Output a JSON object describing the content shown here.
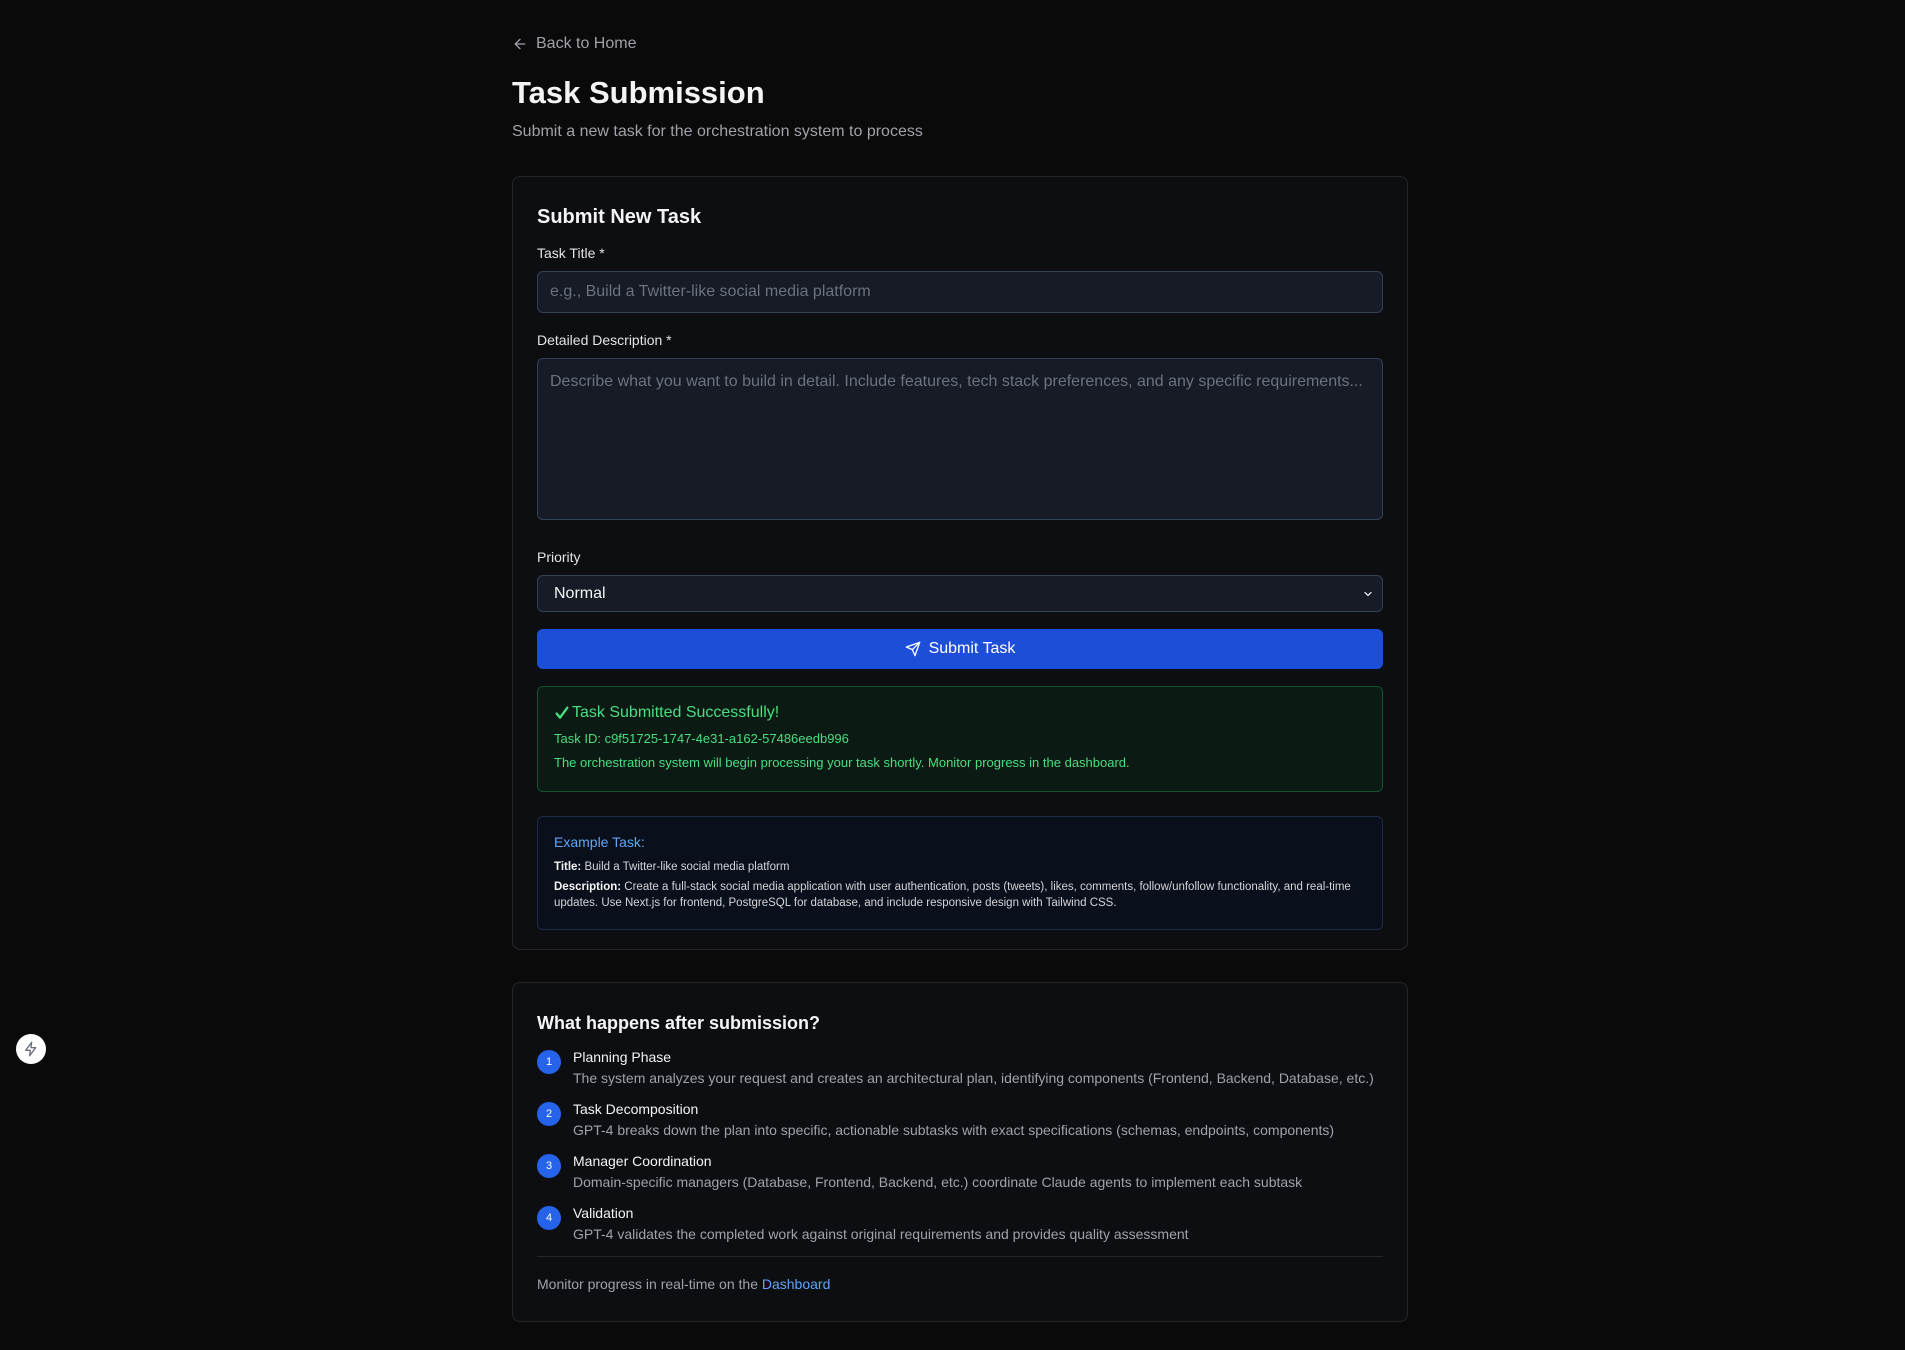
{
  "nav": {
    "back_label": "Back to Home"
  },
  "header": {
    "title": "Task Submission",
    "subtitle": "Submit a new task for the orchestration system to process"
  },
  "form": {
    "card_title": "Submit New Task",
    "title_label": "Task Title *",
    "title_placeholder": "e.g., Build a Twitter-like social media platform",
    "title_value": "",
    "description_label": "Detailed Description *",
    "description_placeholder": "Describe what you want to build in detail. Include features, tech stack preferences, and any specific requirements...",
    "description_value": "",
    "priority_label": "Priority",
    "priority_value": "Normal",
    "submit_label": "Submit Task"
  },
  "success": {
    "title": "Task Submitted Successfully!",
    "task_id": "Task ID: c9f51725-1747-4e31-a162-57486eedb996",
    "message": "The orchestration system will begin processing your task shortly. Monitor progress in the dashboard."
  },
  "example": {
    "heading": "Example Task:",
    "title_key": "Title:",
    "title_value": "Build a Twitter-like social media platform",
    "description_key": "Description:",
    "description_value": "Create a full-stack social media application with user authentication, posts (tweets), likes, comments, follow/unfollow functionality, and real-time updates. Use Next.js for frontend, PostgreSQL for database, and include responsive design with Tailwind CSS."
  },
  "steps": {
    "title": "What happens after submission?",
    "items": [
      {
        "num": "1",
        "name": "Planning Phase",
        "desc": "The system analyzes your request and creates an architectural plan, identifying components (Frontend, Backend, Database, etc.)"
      },
      {
        "num": "2",
        "name": "Task Decomposition",
        "desc": "GPT-4 breaks down the plan into specific, actionable subtasks with exact specifications (schemas, endpoints, components)"
      },
      {
        "num": "3",
        "name": "Manager Coordination",
        "desc": "Domain-specific managers (Database, Frontend, Backend, etc.) coordinate Claude agents to implement each subtask"
      },
      {
        "num": "4",
        "name": "Validation",
        "desc": "GPT-4 validates the completed work against original requirements and provides quality assessment"
      }
    ],
    "monitor_text": "Monitor progress in real-time on the ",
    "monitor_link": "Dashboard"
  },
  "icons": {
    "back": "arrow-left-icon",
    "submit": "send-icon",
    "success": "check-icon",
    "chevron": "chevron-down-icon",
    "floating": "bolt-icon"
  },
  "colors": {
    "background": "#0a0a0b",
    "primary_button": "#1d4ed8",
    "success_text": "#4ade80",
    "link": "#60a5fa",
    "step_badge": "#2563eb"
  }
}
